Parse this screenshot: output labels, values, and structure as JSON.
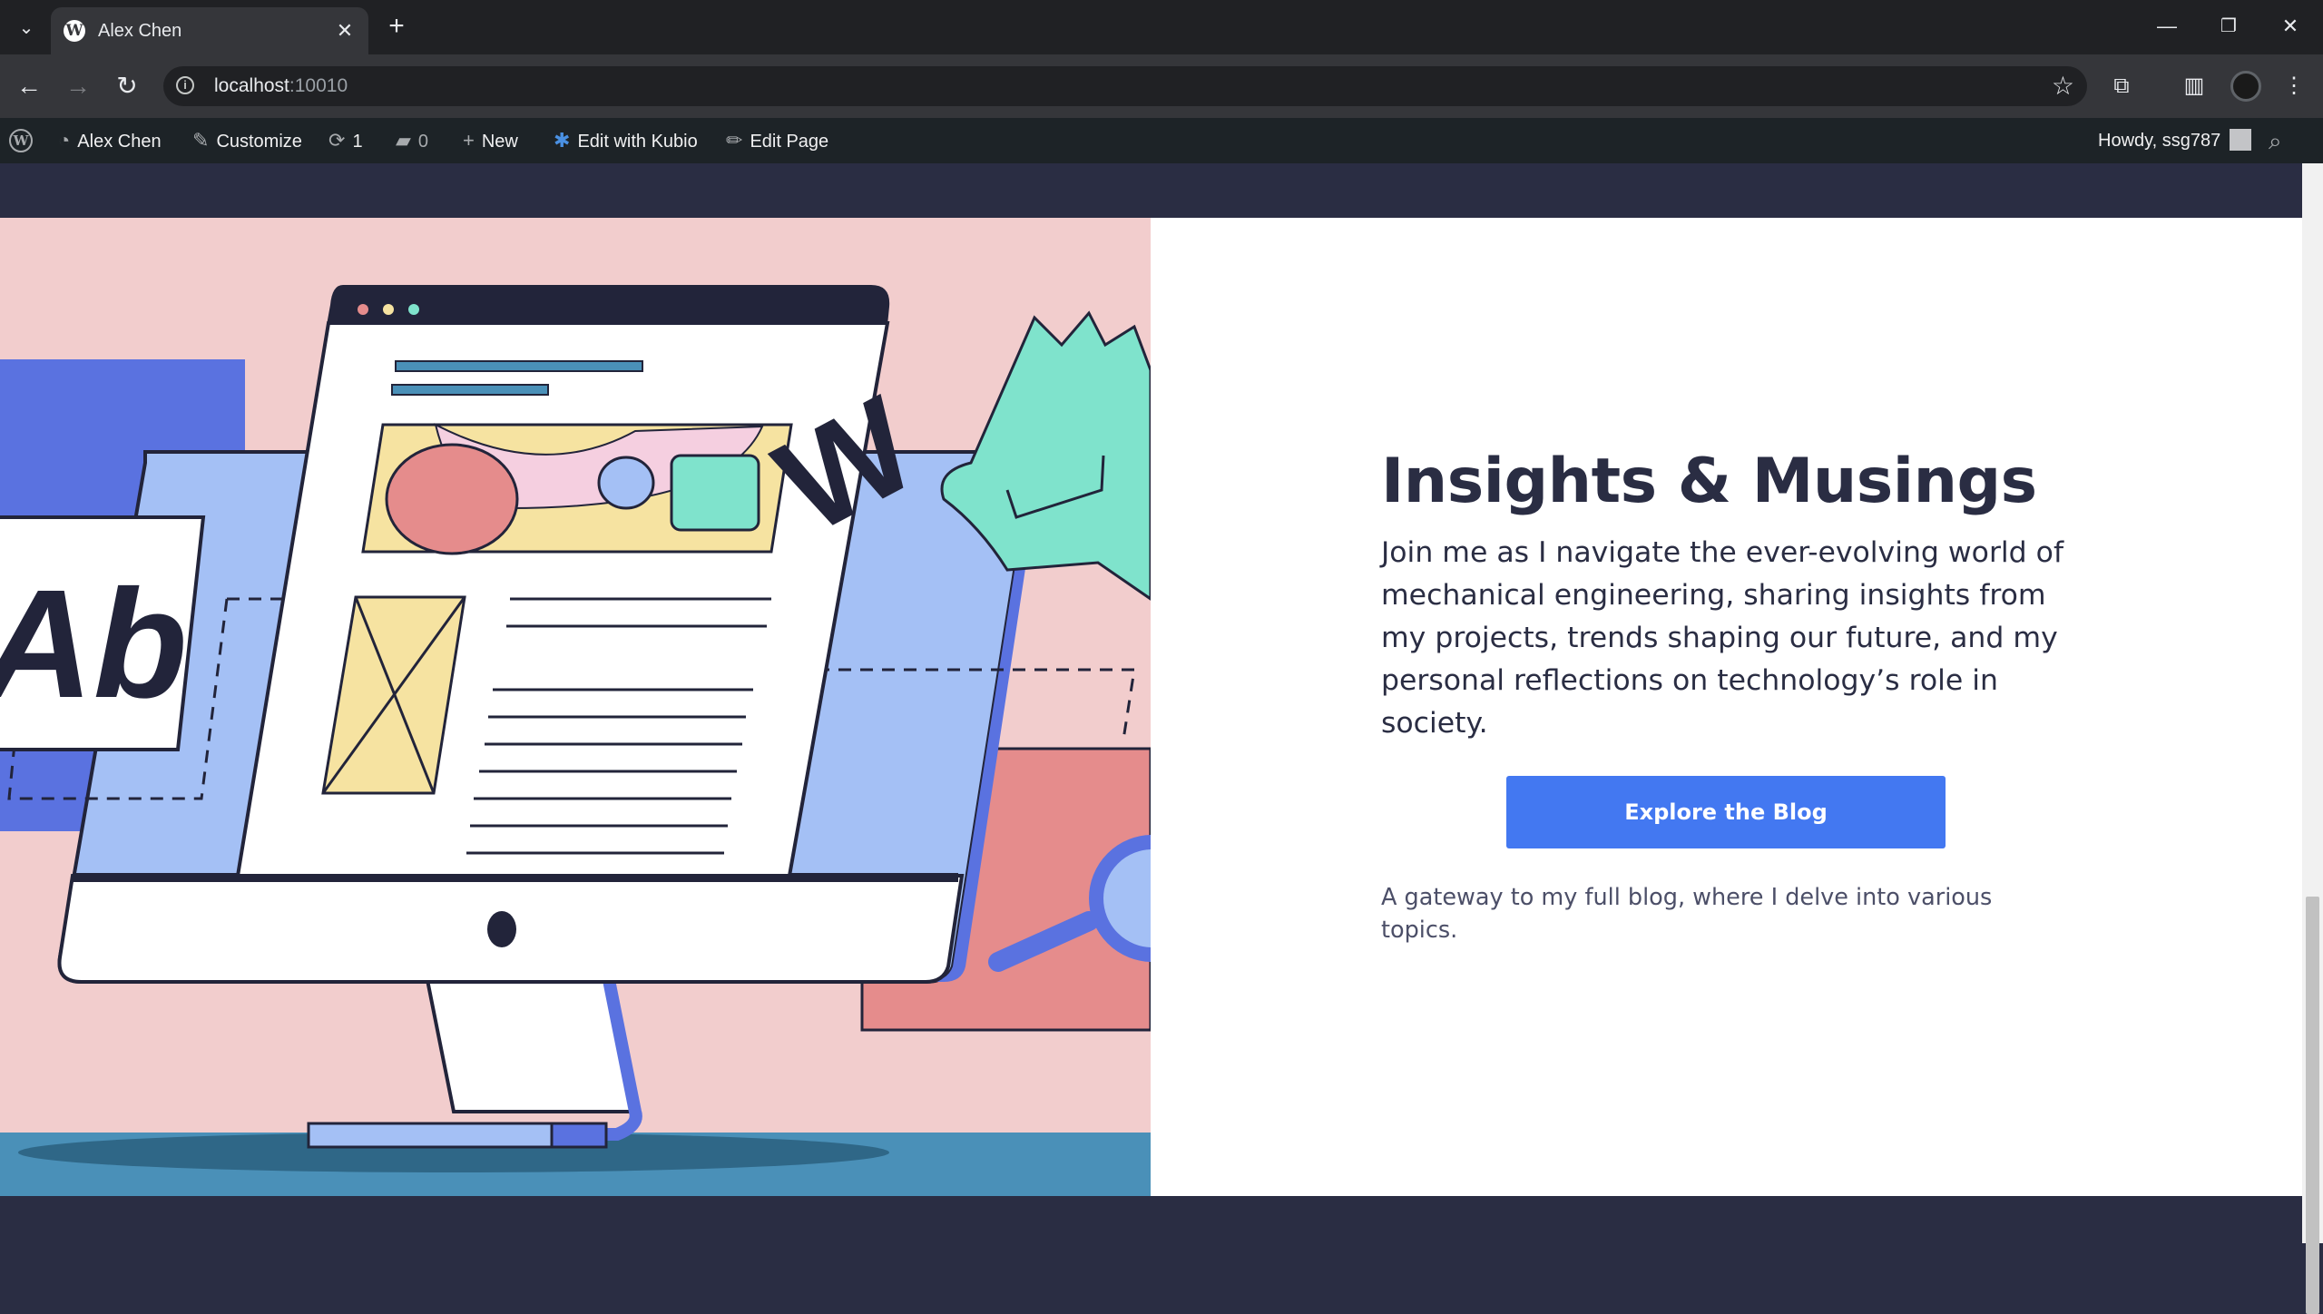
{
  "browser": {
    "tab_title": "Alex Chen",
    "url_host": "localhost",
    "url_port": ":10010"
  },
  "admin_bar": {
    "site_name": "Alex Chen",
    "customize": "Customize",
    "updates_count": "1",
    "comments_count": "0",
    "new": "New",
    "edit_with_kubio": "Edit with Kubio",
    "edit_page": "Edit Page",
    "howdy": "Howdy, ssg787"
  },
  "hero": {
    "heading": "Insights & Musings",
    "lead": "Join me as I navigate the ever-evolving world of mechanical engineering, sharing insights from my projects, trends shaping our future, and my personal reflections on technology’s role in society.",
    "button_label": "Explore the Blog",
    "note": "A gateway to my full blog, where I delve into various topics.",
    "illustration_text": "Ab"
  },
  "colors": {
    "brand_dark": "#2a2d43",
    "button_blue": "#4378f1",
    "illustration_bg": "#f2cdcd",
    "admin_bar": "#1d2327"
  }
}
